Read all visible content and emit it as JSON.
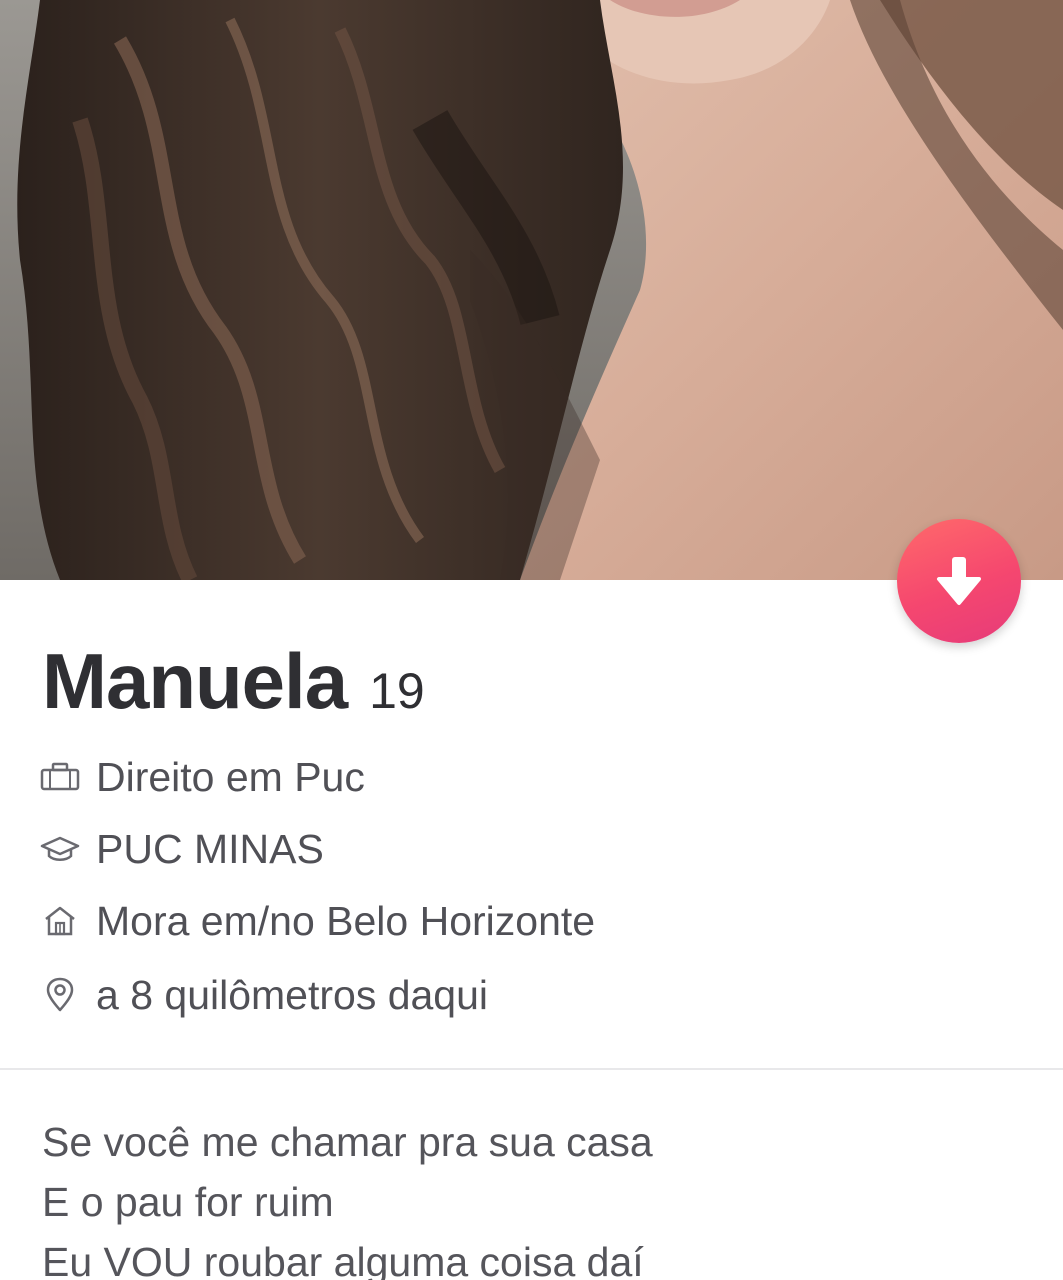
{
  "profile": {
    "name": "Manuela",
    "age": "19",
    "job": "Direito em Puc",
    "school": "PUC MINAS",
    "lives_in": "Mora em/no Belo Horizonte",
    "distance": "a 8 quilômetros daqui",
    "bio": [
      "Se você me chamar pra sua casa",
      "E o pau for ruim",
      "Eu VOU roubar alguma coisa daí"
    ]
  },
  "icons": {
    "job": "briefcase-icon",
    "school": "graduation-cap-icon",
    "home": "home-icon",
    "distance": "location-pin-icon",
    "info_button": "arrow-down-icon"
  },
  "colors": {
    "accent_start": "#ff6a6a",
    "accent_end": "#e63b7a",
    "name_text": "#2f2f33",
    "detail_text": "#505056",
    "divider": "#e8e8ea"
  }
}
